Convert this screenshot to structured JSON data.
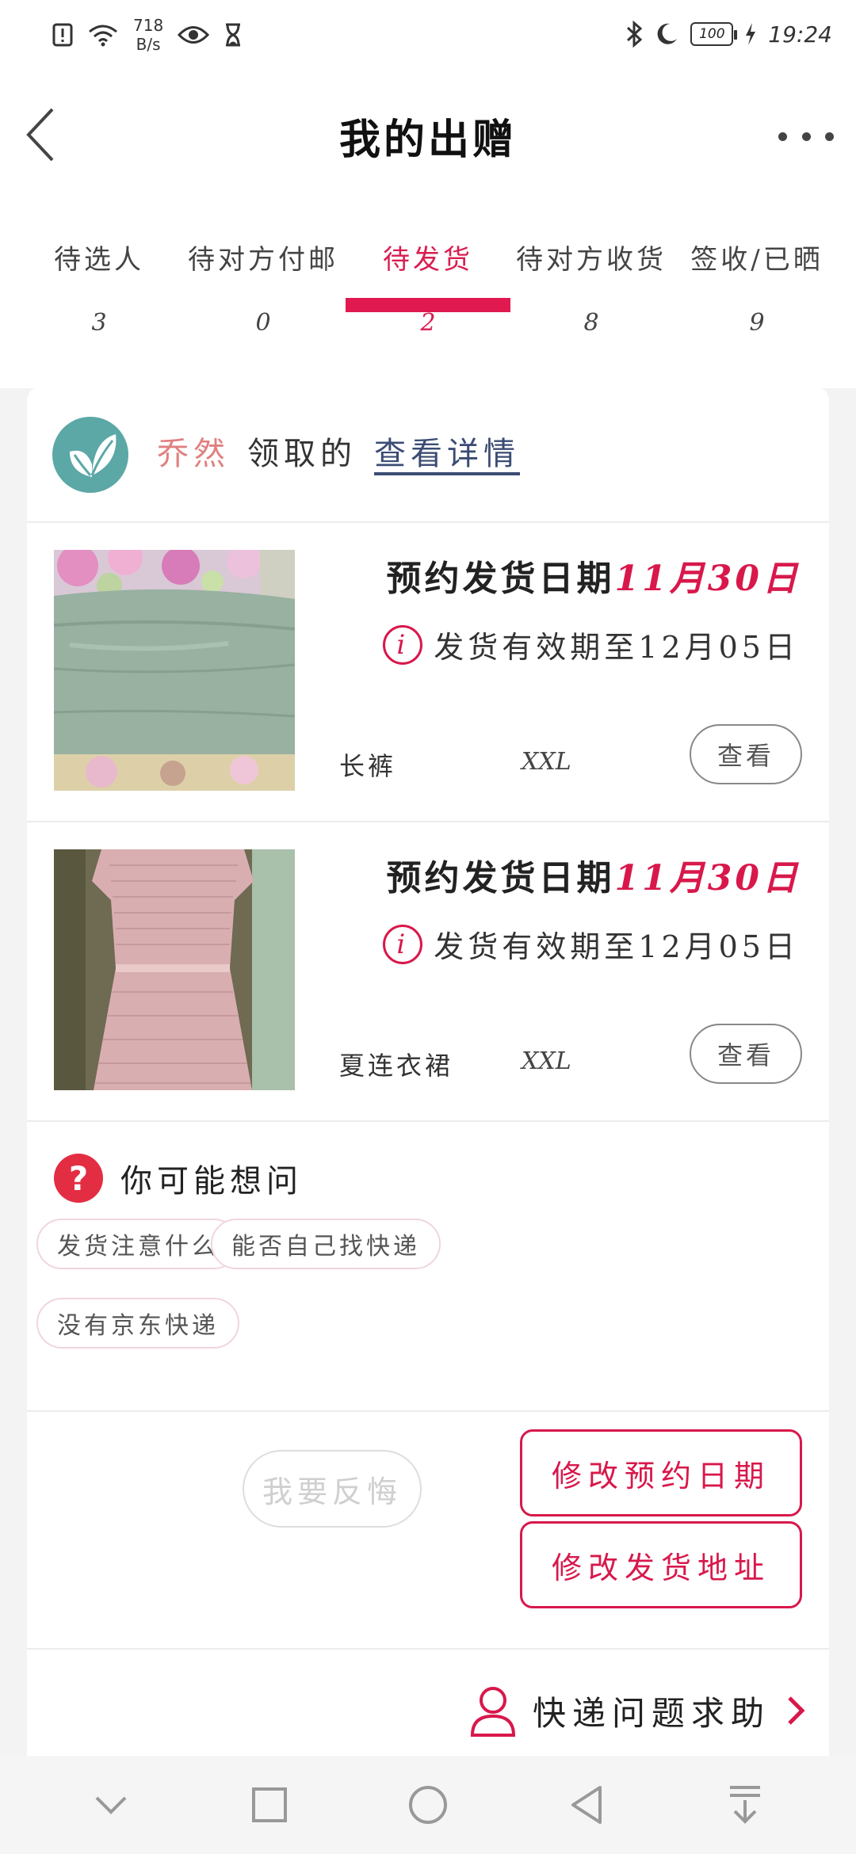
{
  "status_bar": {
    "net_speed_value": "718",
    "net_speed_unit": "B/s",
    "battery": "100",
    "time": "19:24"
  },
  "header": {
    "title": "我的出赠"
  },
  "tabs": [
    {
      "label": "待选人",
      "count": "3"
    },
    {
      "label": "待对方付邮",
      "count": "0"
    },
    {
      "label": "待发货",
      "count": "2",
      "active": true
    },
    {
      "label": "待对方收货",
      "count": "8"
    },
    {
      "label": "签收/已晒",
      "count": "9"
    }
  ],
  "giver": {
    "name": "乔然",
    "action": "领取的",
    "link": "查看详情"
  },
  "items": [
    {
      "date_prefix": "预约发货日期",
      "date_value": "11月30日",
      "deadline": "发货有效期至12月05日",
      "name": "长裤",
      "size": "XXL",
      "button": "查看",
      "image": "grey-green-trousers-photo"
    },
    {
      "date_prefix": "预约发货日期",
      "date_value": "11月30日",
      "deadline": "发货有效期至12月05日",
      "name": "夏连衣裙",
      "size": "XXL",
      "button": "查看",
      "image": "pink-striped-dress-photo"
    }
  ],
  "faq": {
    "title": "你可能想问",
    "chips": [
      "发货注意什么",
      "能否自己找快递",
      "没有京东快递"
    ]
  },
  "actions": {
    "regret": "我要反悔",
    "modify_date": "修改预约日期",
    "modify_address": "修改发货地址"
  },
  "help": {
    "label": "快递问题求助"
  },
  "colors": {
    "accent": "#d8184b",
    "tab_indicator": "#e01a50",
    "link": "#3b4c74",
    "question_icon": "#e32d43"
  }
}
